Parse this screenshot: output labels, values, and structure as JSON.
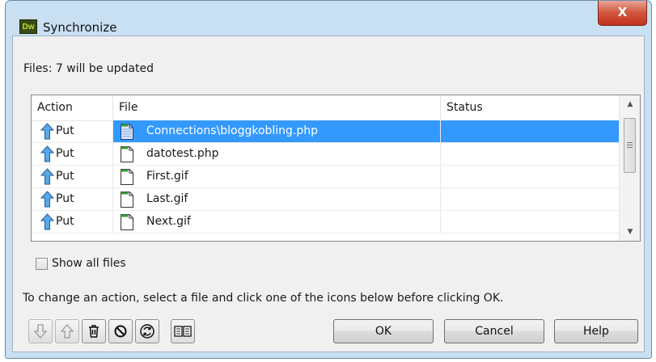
{
  "window": {
    "title": "Synchronize",
    "app_icon_label": "Dw",
    "close_label": "X"
  },
  "summary": "Files: 7 will be updated",
  "columns": {
    "action": "Action",
    "file": "File",
    "status": "Status"
  },
  "rows": [
    {
      "action": "Put",
      "file": "Connections\\bloggkobling.php",
      "status": "",
      "selected": true
    },
    {
      "action": "Put",
      "file": "datotest.php",
      "status": "",
      "selected": false
    },
    {
      "action": "Put",
      "file": "First.gif",
      "status": "",
      "selected": false
    },
    {
      "action": "Put",
      "file": "Last.gif",
      "status": "",
      "selected": false
    },
    {
      "action": "Put",
      "file": "Next.gif",
      "status": "",
      "selected": false
    }
  ],
  "show_all_files": {
    "label": "Show all files",
    "checked": false
  },
  "instruction": "To change an action, select a file and click one of the icons below before clicking OK.",
  "action_icons": [
    {
      "name": "get-icon",
      "enabled": false
    },
    {
      "name": "put-icon",
      "enabled": false
    },
    {
      "name": "delete-icon",
      "enabled": true
    },
    {
      "name": "ignore-icon",
      "enabled": true
    },
    {
      "name": "synchronized-icon",
      "enabled": true
    },
    {
      "name": "compare-icon",
      "enabled": true
    }
  ],
  "buttons": {
    "ok": "OK",
    "cancel": "Cancel",
    "help": "Help"
  },
  "colors": {
    "selection": "#3399ff",
    "frame": "#c9dff2",
    "close": "#c2311c"
  }
}
